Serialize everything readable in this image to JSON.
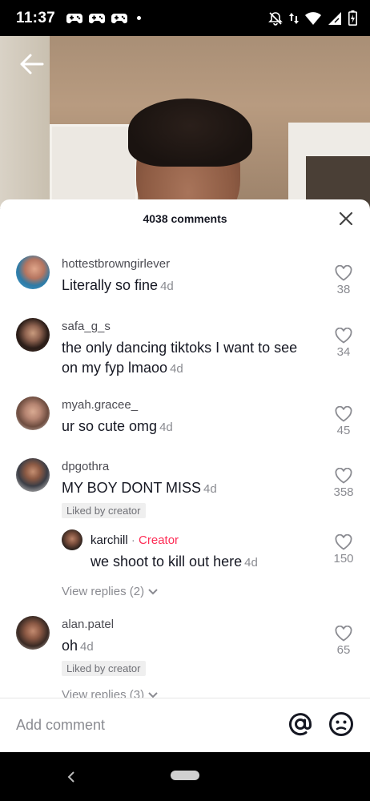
{
  "status_bar": {
    "time": "11:37",
    "left_icons": [
      "game-controller-icon",
      "game-controller-icon",
      "game-controller-icon",
      "notification-dot"
    ],
    "right_icons": [
      "notifications-off-icon",
      "data-arrows-icon",
      "wifi-icon",
      "signal-icon",
      "battery-icon"
    ]
  },
  "header": {
    "comments_count": "4038 comments"
  },
  "comments": [
    {
      "username": "hottestbrowngirlever",
      "text": "Literally so fine",
      "time": "4d",
      "likes": "38"
    },
    {
      "username": "safa_g_s",
      "text_line1": "the only dancing tiktoks I want to see",
      "text_line2": "on my fyp lmaoo",
      "time": "4d",
      "likes": "34"
    },
    {
      "username": "myah.gracee_",
      "text": "ur so cute omg",
      "time": "4d",
      "likes": "45"
    },
    {
      "username": "dpgothra",
      "text": "MY BOY DONT MISS",
      "time": "4d",
      "likes": "358",
      "badge": "Liked by creator"
    },
    {
      "username": "alan.patel",
      "text": "oh",
      "time": "4d",
      "likes": "65",
      "badge": "Liked by creator"
    }
  ],
  "reply": {
    "username": "karchill",
    "separator": "·",
    "creator_label": "Creator",
    "text": "we shoot to kill out here",
    "time": "4d",
    "likes": "150"
  },
  "view_replies": [
    "View replies (2)",
    "View replies (3)"
  ],
  "input": {
    "placeholder": "Add comment"
  },
  "colors": {
    "accent": "#fe2c55",
    "text_primary": "#161823",
    "text_secondary": "#8a8b91"
  }
}
